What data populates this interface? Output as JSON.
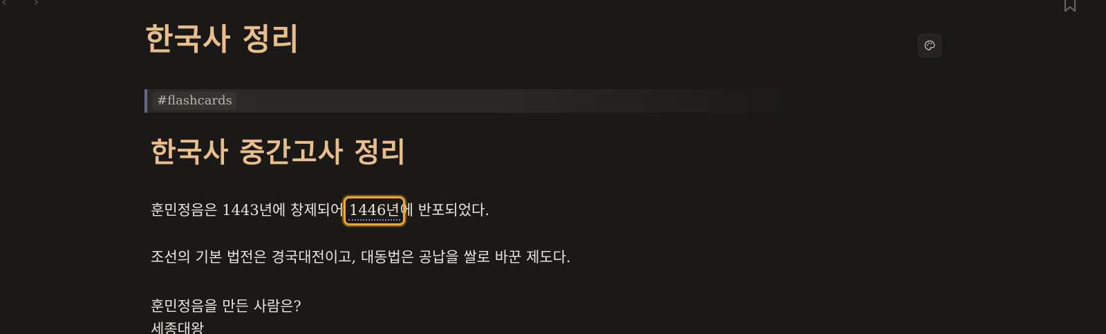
{
  "nav": {
    "arrows": "‹ ›"
  },
  "note": {
    "title": "한국사 정리",
    "tag": "#flashcards",
    "heading": "한국사 중간고사 정리",
    "line1_before": "훈민정음은 1443년에 창제되어 ",
    "line1_cloze": "1446년",
    "line1_after": "에 반포되었다.",
    "line2": "조선의 기본 법전은 경국대전이고, 대동법은 공납을 쌀로 바꾼 제도다.",
    "line3": "훈민정음을 만든 사람은?",
    "line4": "세종대왕"
  },
  "icons": {
    "palette": "palette-icon",
    "bookmark": "bookmark-icon"
  },
  "colors": {
    "background": "#1a1918",
    "heading": "#e7be8c",
    "highlight": "#f0a636",
    "tag_border": "#5f6a85"
  }
}
